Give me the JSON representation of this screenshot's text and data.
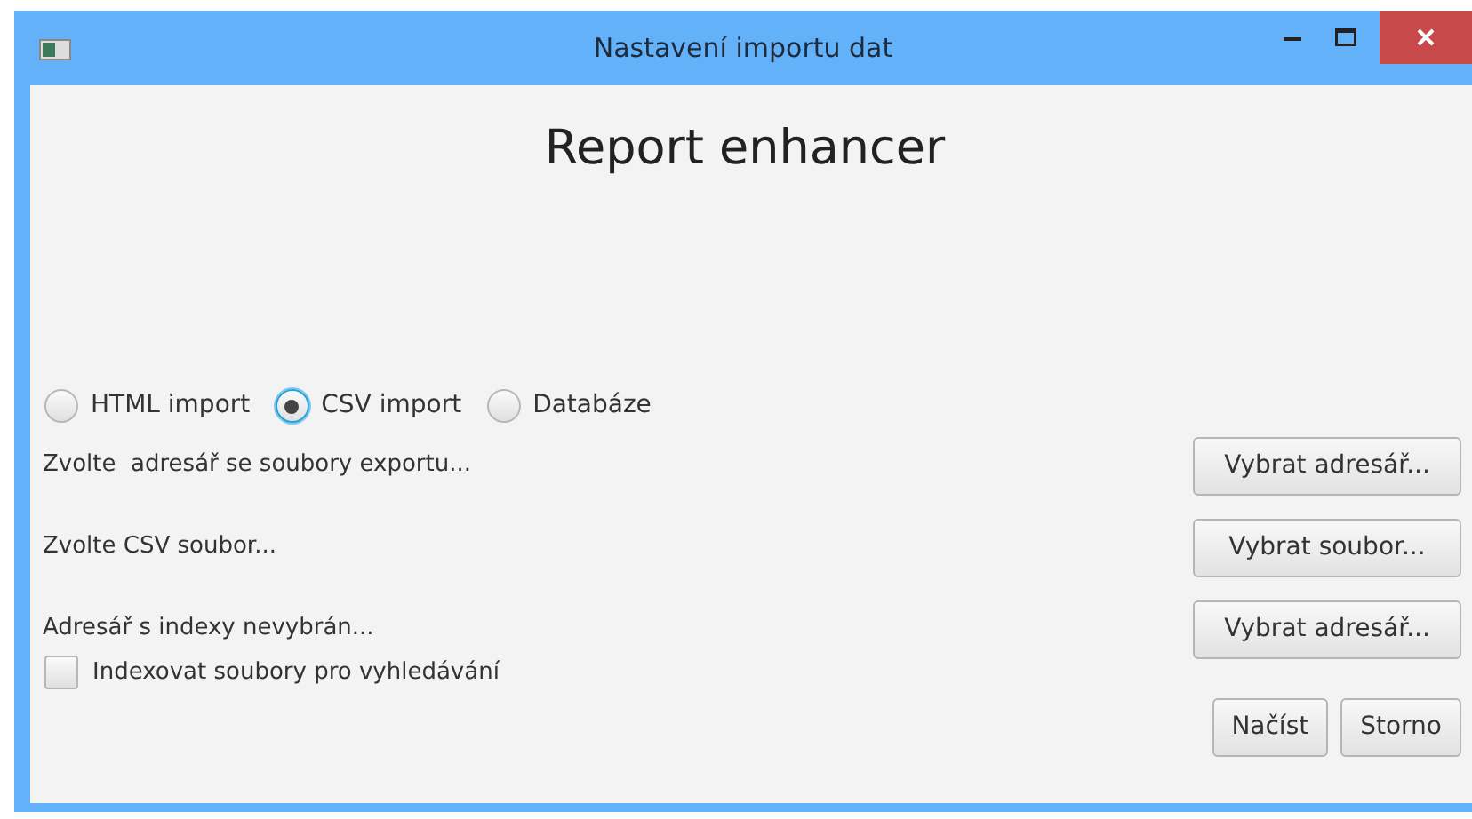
{
  "window": {
    "title": "Nastavení importu dat"
  },
  "heading": "Report enhancer",
  "import_types": [
    {
      "label": "HTML import",
      "selected": false
    },
    {
      "label": "CSV import",
      "selected": true
    },
    {
      "label": "Databáze",
      "selected": false
    }
  ],
  "rows": [
    {
      "label": "Zvolte  adresář se soubory exportu...",
      "button": "Vybrat adresář..."
    },
    {
      "label": "Zvolte CSV soubor...",
      "button": "Vybrat soubor..."
    },
    {
      "label": "Adresář s indexy nevybrán...",
      "button": "Vybrat adresář..."
    }
  ],
  "index_option": {
    "label": "Indexovat soubory pro vyhledávání",
    "checked": false
  },
  "buttons": [
    "Načíst",
    "Storno"
  ]
}
